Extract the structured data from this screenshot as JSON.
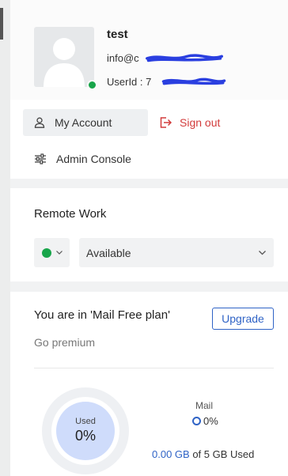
{
  "profile": {
    "name": "test",
    "email_prefix": "info@c",
    "userid_label": "UserId : 7"
  },
  "account": {
    "my_account_label": "My Account",
    "sign_out_label": "Sign out",
    "admin_console_label": "Admin Console"
  },
  "remote_work": {
    "title": "Remote Work",
    "availability": "Available"
  },
  "plan": {
    "title": "You are in 'Mail Free plan'",
    "upgrade_label": "Upgrade",
    "go_premium_label": "Go premium",
    "used_label": "Used",
    "used_percent": "0%",
    "mail_label": "Mail",
    "mail_percent": "0%",
    "storage_used": "0.00 GB",
    "storage_total_text": " of 5 GB Used"
  },
  "colors": {
    "accent": "#2f63c6",
    "danger": "#d23b3b",
    "online": "#18a54a",
    "redaction": "#2a3fe0"
  }
}
